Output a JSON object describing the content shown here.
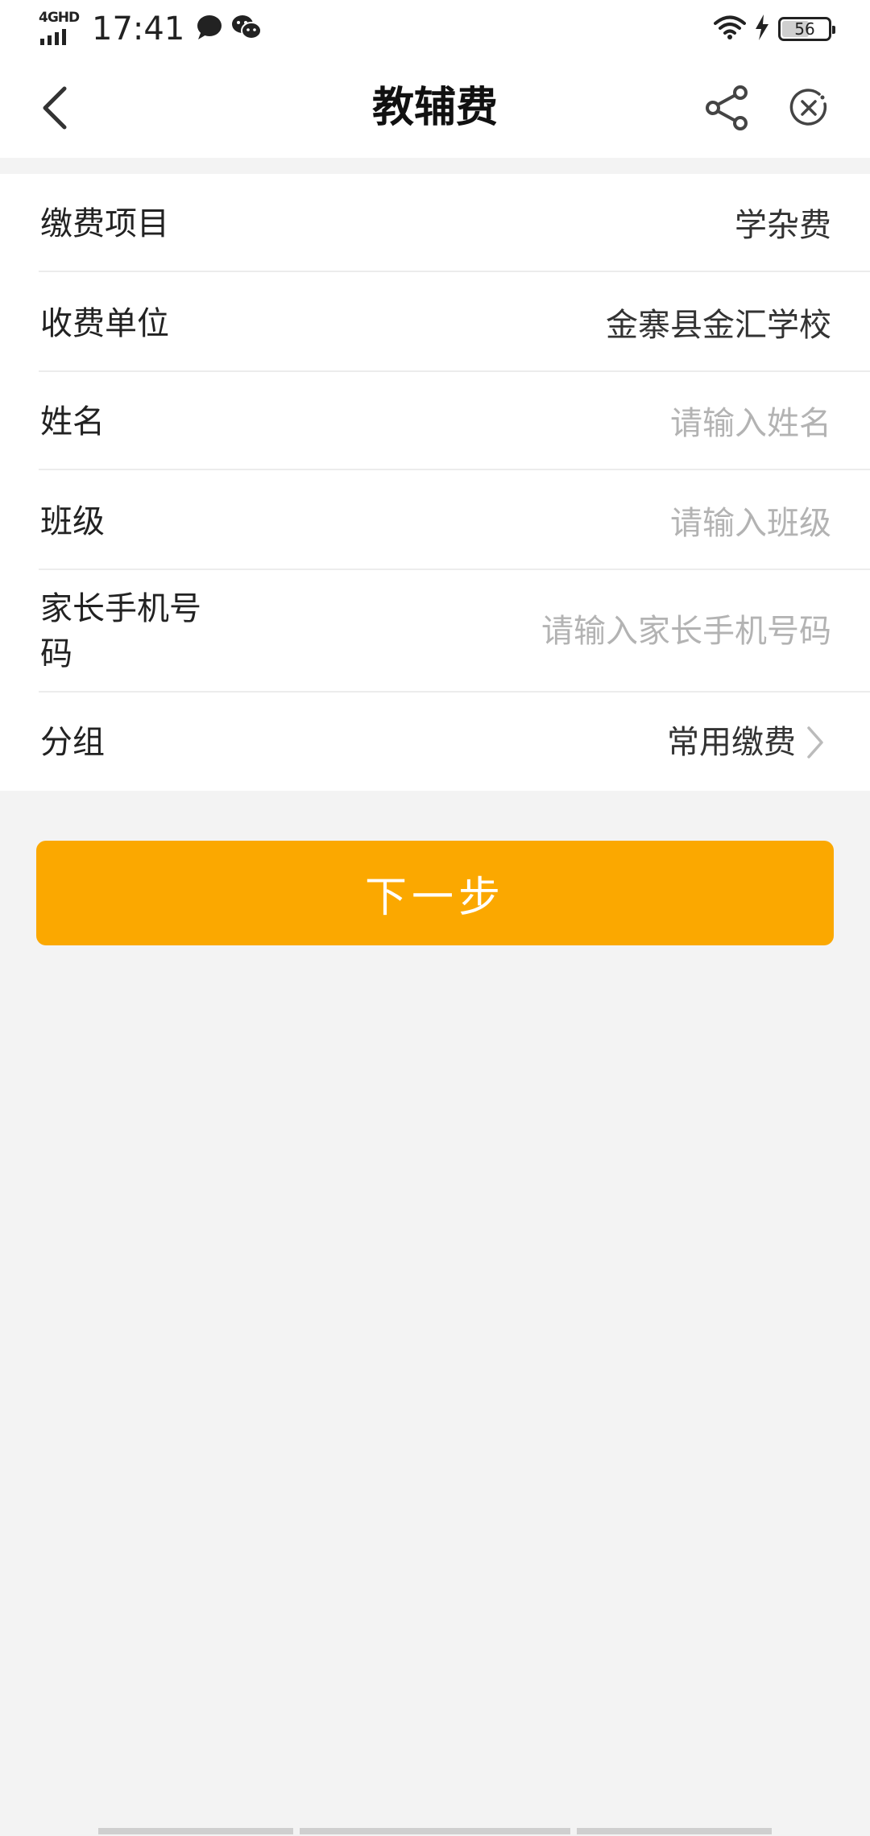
{
  "status_bar": {
    "network": "4GHD",
    "time": "17:41",
    "battery_level": "56",
    "icons": [
      "signal-icon",
      "message-icon",
      "wechat-icon",
      "wifi-icon",
      "charging-icon",
      "battery-icon"
    ]
  },
  "header": {
    "title": "教辅费",
    "back_icon": "chevron-left-icon",
    "share_icon": "share-icon",
    "close_icon": "close-circle-icon"
  },
  "form": {
    "payment_item": {
      "label": "缴费项目",
      "value": "学杂费"
    },
    "payee": {
      "label": "收费单位",
      "value": "金寨县金汇学校"
    },
    "name": {
      "label": "姓名",
      "value": "",
      "placeholder": "请输入姓名"
    },
    "class": {
      "label": "班级",
      "value": "",
      "placeholder": "请输入班级"
    },
    "parent_phone": {
      "label_line1": "家长手机号",
      "label_line2": "码",
      "value": "",
      "placeholder": "请输入家长手机号码"
    },
    "group": {
      "label": "分组",
      "value": "常用缴费"
    }
  },
  "next_button": {
    "label": "下一步"
  },
  "colors": {
    "accent": "#fba800",
    "background": "#f3f3f3",
    "placeholder": "#b3b3b3"
  }
}
